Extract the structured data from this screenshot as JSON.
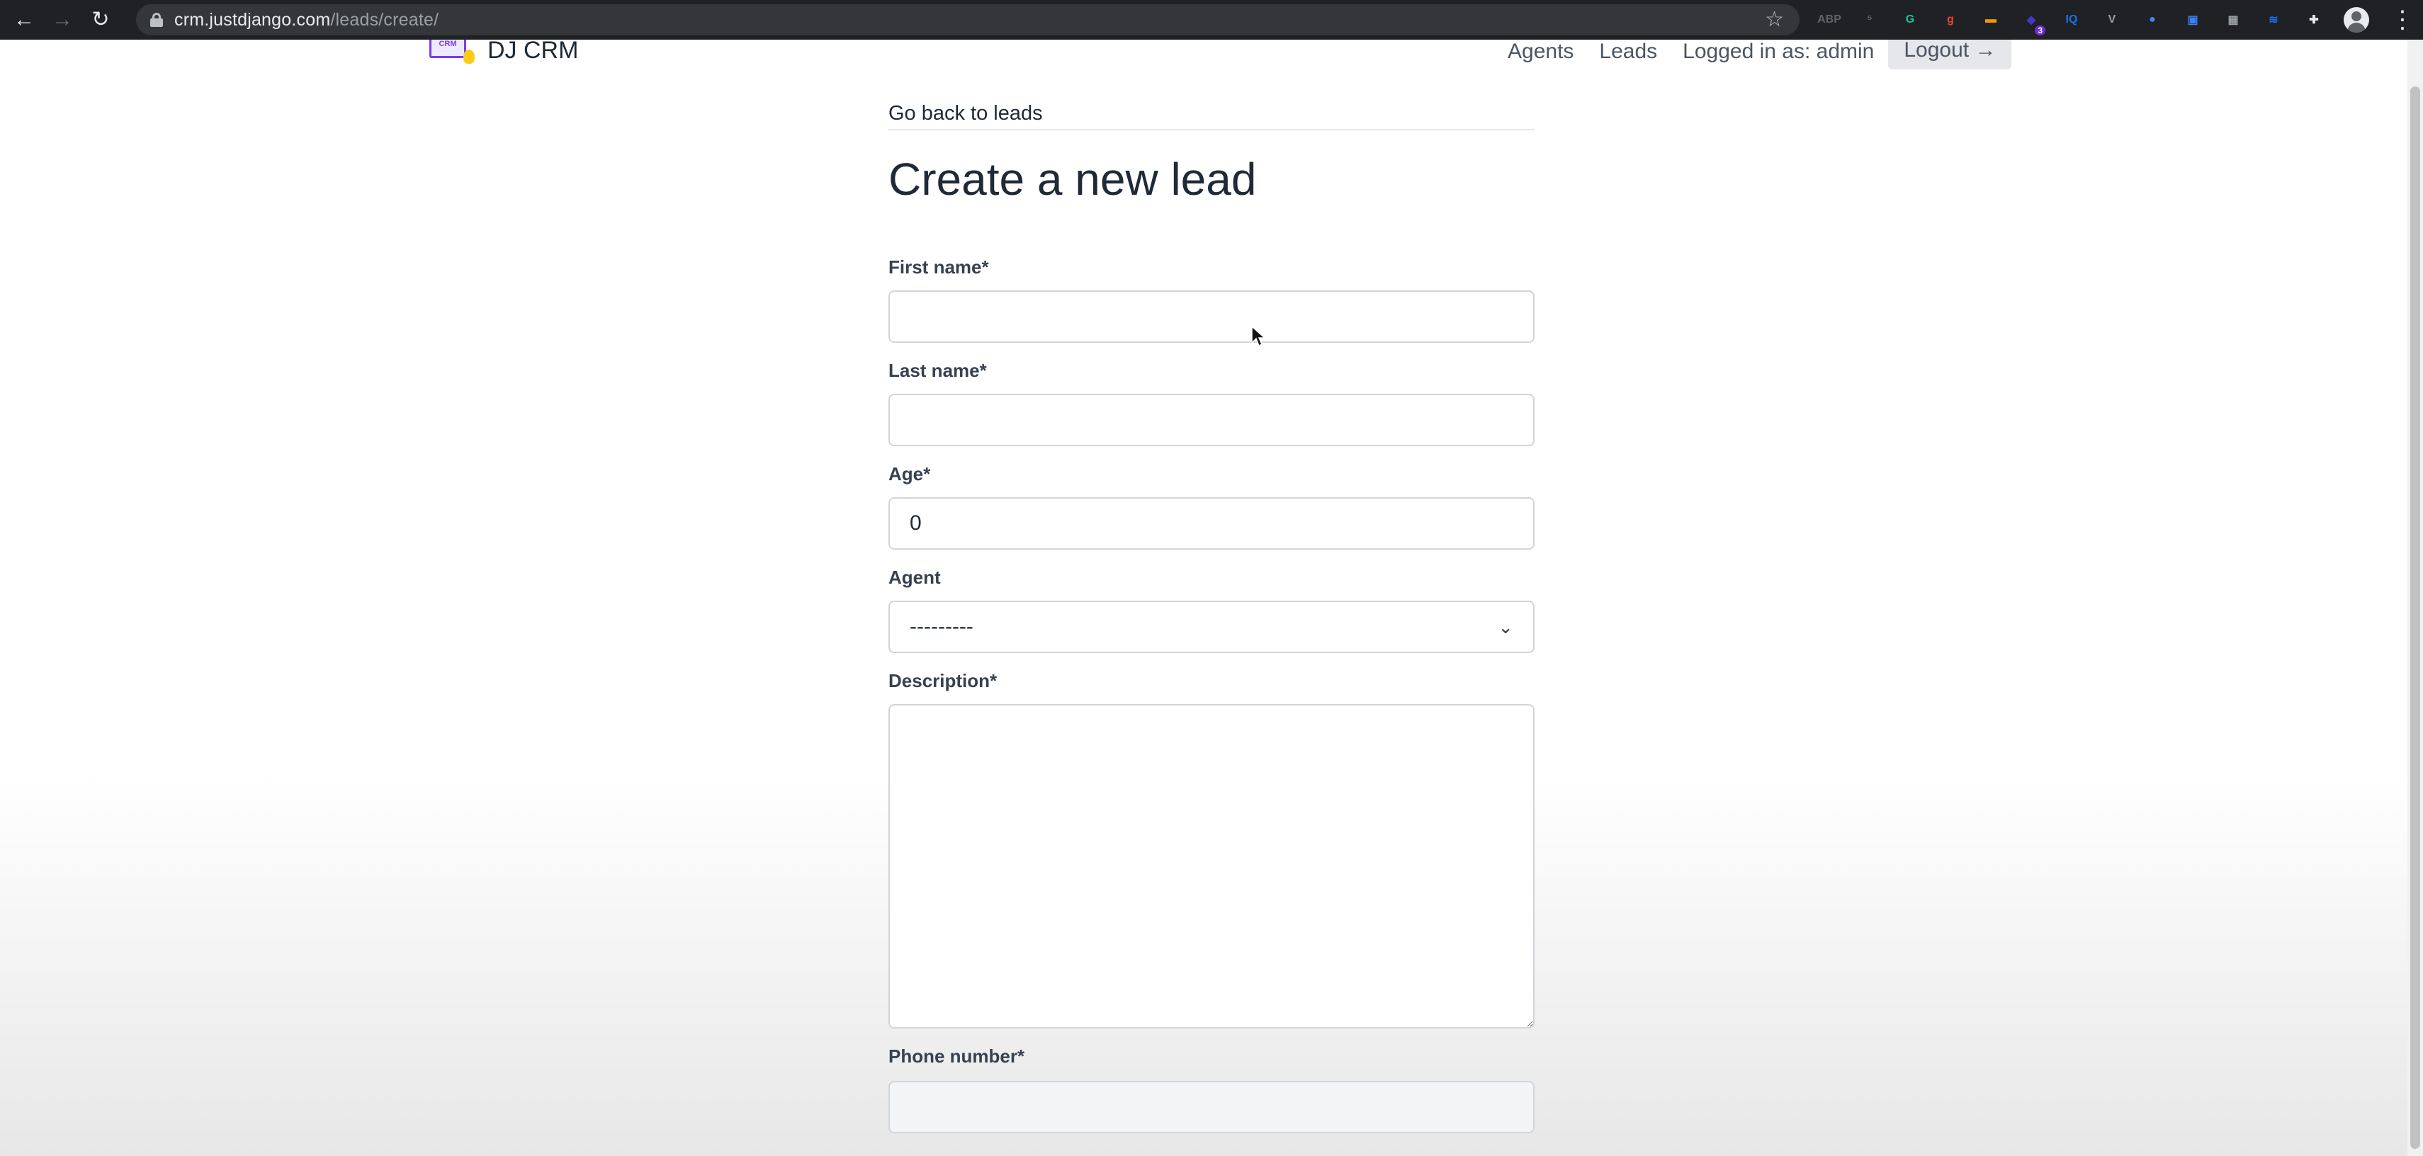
{
  "browser": {
    "url_host": "crm.justdjango.com",
    "url_path": "/leads/create/",
    "extensions": [
      {
        "name": "adblock-extension-icon",
        "text": "ABP",
        "color": "#5f6368"
      },
      {
        "name": "extension-2-icon",
        "text": "⁵",
        "color": "#5f6368"
      },
      {
        "name": "grammarly-icon",
        "text": "G",
        "color": "#15c39a"
      },
      {
        "name": "google-extension-icon",
        "text": "g",
        "color": "#ea4335"
      },
      {
        "name": "orange-extension-icon",
        "text": "▬",
        "color": "#f29900"
      },
      {
        "name": "badge-extension-icon",
        "text": "◆",
        "color": "#4338ca",
        "badge": "3"
      },
      {
        "name": "iq-extension-icon",
        "text": "IQ",
        "color": "#1a73e8"
      },
      {
        "name": "v-extension-icon",
        "text": "V",
        "color": "#9aa0a6"
      },
      {
        "name": "blue-circle-extension-icon",
        "text": "●",
        "color": "#4285f4"
      },
      {
        "name": "window-extension-icon",
        "text": "▣",
        "color": "#3b82f6"
      },
      {
        "name": "photo-extension-icon",
        "text": "▦",
        "color": "#9aa0a6"
      },
      {
        "name": "stack-extension-icon",
        "text": "≋",
        "color": "#1a73e8"
      },
      {
        "name": "puzzle-extensions-icon",
        "text": "✚",
        "color": "#e8eaed"
      }
    ]
  },
  "header": {
    "brand": "DJ CRM",
    "logo_text": "CRM",
    "nav": {
      "agents": "Agents",
      "leads": "Leads",
      "logged_in": "Logged in as: admin",
      "logout": "Logout →"
    }
  },
  "form": {
    "back_link": "Go back to leads",
    "title": "Create a new lead",
    "first_name": {
      "label": "First name*",
      "value": ""
    },
    "last_name": {
      "label": "Last name*",
      "value": ""
    },
    "age": {
      "label": "Age*",
      "value": "0"
    },
    "agent": {
      "label": "Agent",
      "selected": "---------"
    },
    "description": {
      "label": "Description*",
      "value": ""
    },
    "phone": {
      "label": "Phone number*",
      "value": ""
    }
  }
}
